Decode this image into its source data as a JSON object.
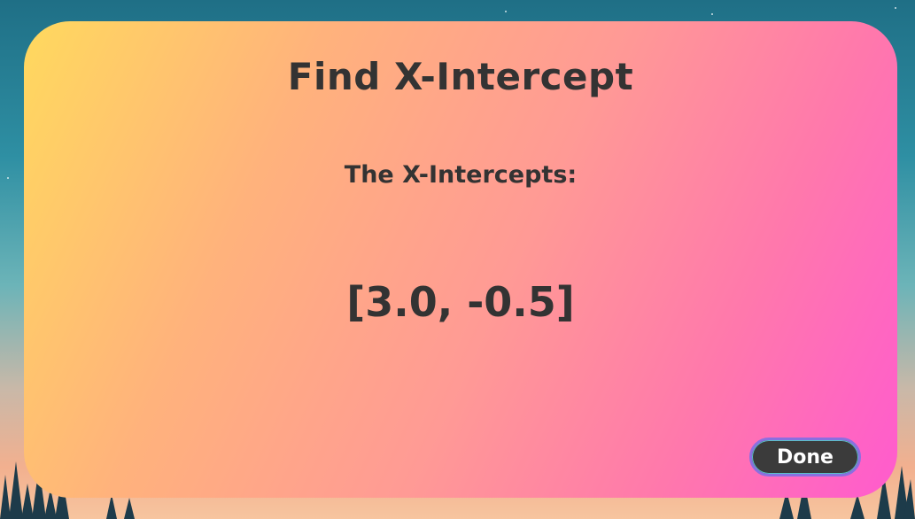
{
  "dialog": {
    "title": "Find X-Intercept",
    "subtitle": "The X-Intercepts:",
    "result": "[3.0, -0.5]",
    "done_label": "Done"
  },
  "colors": {
    "gradient_start": "#ffd95e",
    "gradient_end": "#ff5bce",
    "text": "#333333",
    "button_bg": "#3b3b3b",
    "button_text": "#ffffff"
  }
}
